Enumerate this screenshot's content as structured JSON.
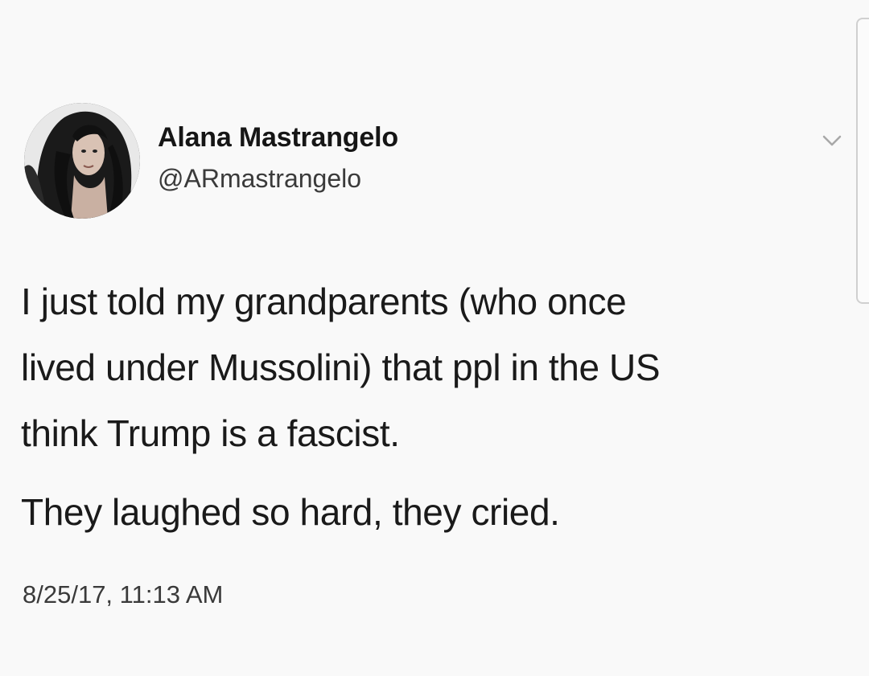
{
  "tweet": {
    "author": {
      "display_name": "Alana Mastrangelo",
      "handle": "@ARmastrangelo",
      "avatar_icon": "profile-photo"
    },
    "menu_icon": "chevron-down-icon",
    "text_lines": [
      "I just told my grandparents (who once",
      "lived under Mussolini) that ppl in the US",
      "think Trump is a fascist."
    ],
    "text_second_paragraph": "They laughed so hard, they cried.",
    "timestamp": "8/25/17, 11:13 AM"
  },
  "colors": {
    "background": "#f9f9f9",
    "primary_text": "#1a1a1a",
    "secondary_text": "#3a3a3a"
  }
}
